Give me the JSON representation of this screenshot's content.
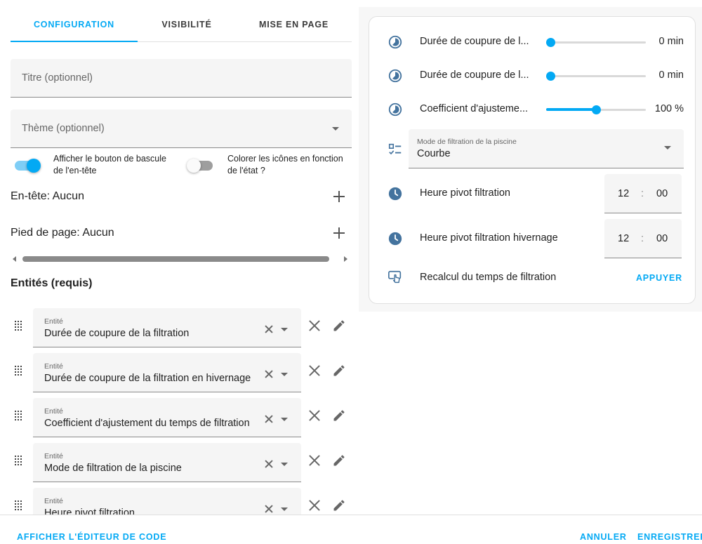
{
  "tabs": [
    {
      "label": "CONFIGURATION",
      "active": true
    },
    {
      "label": "VISIBILITÉ",
      "active": false
    },
    {
      "label": "MISE EN PAGE",
      "active": false
    }
  ],
  "title_field": {
    "placeholder": "Titre (optionnel)"
  },
  "theme_field": {
    "placeholder": "Thème (optionnel)"
  },
  "toggles": {
    "header_toggle": {
      "label_line1": "Afficher le bouton de bascule",
      "label_line2": "de l'en-tête",
      "on": true
    },
    "state_color": {
      "label_line1": "Colorer les icônes en fonction",
      "label_line2": "de l'état ?",
      "on": false
    }
  },
  "header_row": {
    "label": "En-tête: Aucun"
  },
  "footer_row": {
    "label": "Pied de page: Aucun"
  },
  "entities_section": {
    "title": "Entités (requis)"
  },
  "entities": [
    {
      "float_label": "Entité",
      "value": "Durée de coupure de la filtration"
    },
    {
      "float_label": "Entité",
      "value": "Durée de coupure de la filtration en hivernage"
    },
    {
      "float_label": "Entité",
      "value": "Coefficient d'ajustement du temps de filtration"
    },
    {
      "float_label": "Entité",
      "value": "Mode de filtration de la piscine"
    },
    {
      "float_label": "Entité",
      "value": "Heure pivot filtration"
    }
  ],
  "preview": {
    "sliders": [
      {
        "label": "Durée de coupure de l...",
        "value": "0 min",
        "level": 0.0,
        "icon": "timelapse-icon"
      },
      {
        "label": "Durée de coupure de l...",
        "value": "0 min",
        "level": 0.0,
        "icon": "timelapse-icon"
      },
      {
        "label": "Coefficient d'ajusteme...",
        "value": "100 %",
        "level": 0.5,
        "icon": "timelapse-icon"
      }
    ],
    "select": {
      "float_label": "Mode de filtration de la piscine",
      "value": "Courbe",
      "icon": "format-list-checks-icon"
    },
    "times": [
      {
        "label": "Heure pivot filtration",
        "hours": "12",
        "separator": ":",
        "minutes": "00",
        "icon": "clock-icon"
      },
      {
        "label": "Heure pivot filtration hivernage",
        "hours": "12",
        "separator": ":",
        "minutes": "00",
        "icon": "clock-icon"
      }
    ],
    "button_row": {
      "label": "Recalcul du temps de filtration",
      "action": "APPUYER",
      "icon": "gesture-tap-button-icon"
    }
  },
  "footer": {
    "code_editor": "AFFICHER L'ÉDITEUR DE CODE",
    "cancel": "ANNULER",
    "save": "ENREGISTRER"
  },
  "colors": {
    "accent": "#03a9f4",
    "icon_state": "#44739e"
  }
}
